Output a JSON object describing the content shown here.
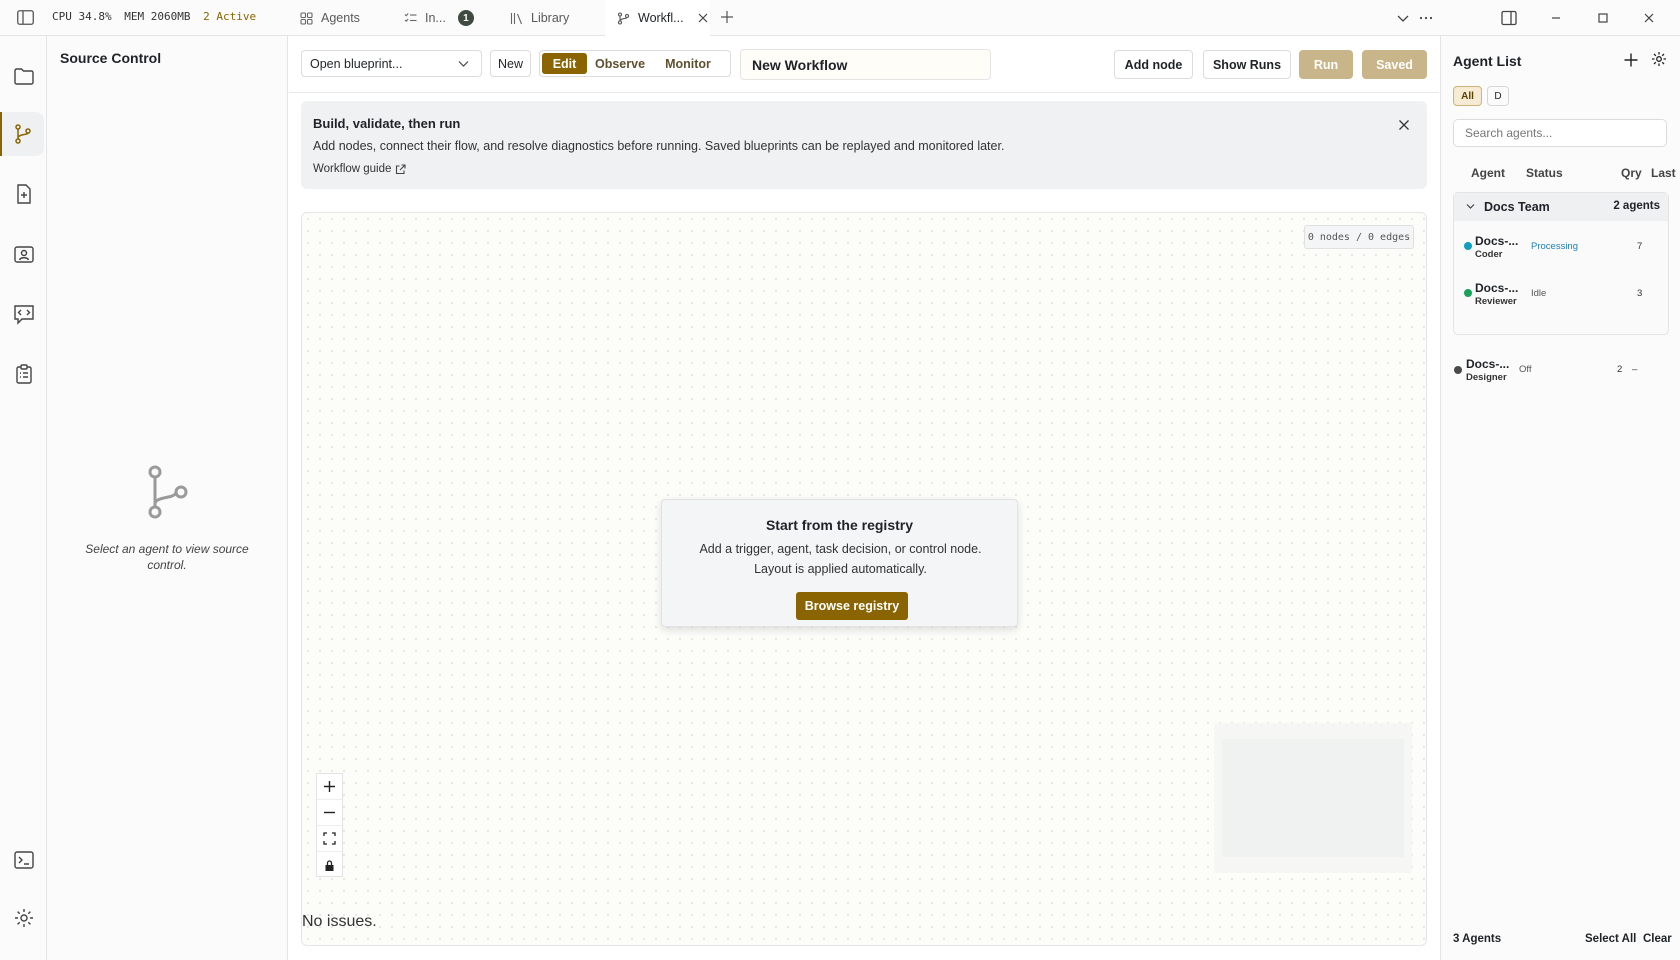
{
  "topbar": {
    "cpu": "CPU 34.8%",
    "mem": "MEM 2060MB",
    "active": "2 Active",
    "tabs": [
      {
        "label": "Agents",
        "icon": "grid-icon"
      },
      {
        "label": "In...",
        "icon": "checklist-icon",
        "badge": "1"
      },
      {
        "label": "Library",
        "icon": "library-icon"
      },
      {
        "label": "Workfl...",
        "icon": "branch-icon",
        "selected": true
      }
    ]
  },
  "source_control": {
    "title": "Source Control",
    "empty_text": "Select an agent to view source control."
  },
  "toolbar": {
    "blueprint_select": "Open blueprint...",
    "new_label": "New",
    "modes": [
      "Edit",
      "Observe",
      "Monitor"
    ],
    "active_mode": "Edit",
    "workflow_name": "New Workflow",
    "add_node": "Add node",
    "show_runs": "Show Runs",
    "run": "Run",
    "saved": "Saved"
  },
  "banner": {
    "title": "Build, validate, then run",
    "text": "Add nodes, connect their flow, and resolve diagnostics before running. Saved blueprints can be replayed and monitored later.",
    "link": "Workflow guide"
  },
  "canvas": {
    "counter": "0 nodes / 0 edges",
    "start_title": "Start from the registry",
    "start_desc": "Add a trigger, agent, task decision, or control node. Layout is applied automatically.",
    "browse": "Browse registry",
    "issues": "No issues."
  },
  "agent_panel": {
    "title": "Agent List",
    "filters": [
      "All",
      "D"
    ],
    "search_placeholder": "Search agents...",
    "columns": {
      "agent": "Agent",
      "status": "Status",
      "qry": "Qry",
      "last": "Last"
    },
    "team": {
      "name": "Docs Team",
      "count": "2 agents"
    },
    "agents": [
      {
        "name": "Docs-...",
        "role": "Coder",
        "status": "Processing",
        "qry": "7",
        "last": "",
        "dot_color": "#0f9fbf",
        "status_color": "#1d7fb5"
      },
      {
        "name": "Docs-...",
        "role": "Reviewer",
        "status": "Idle",
        "qry": "3",
        "last": "",
        "dot_color": "#17a35a",
        "status_color": "#555555"
      },
      {
        "name": "Docs-...",
        "role": "Designer",
        "status": "Off",
        "qry": "2",
        "last": "–",
        "dot_color": "#4a4a4a",
        "status_color": "#555555"
      }
    ],
    "footer_count": "3 Agents",
    "select_all": "Select All",
    "clear": "Clear"
  },
  "colors": {
    "accent": "#8a6400",
    "accent_disabled": "#c9b58a"
  }
}
